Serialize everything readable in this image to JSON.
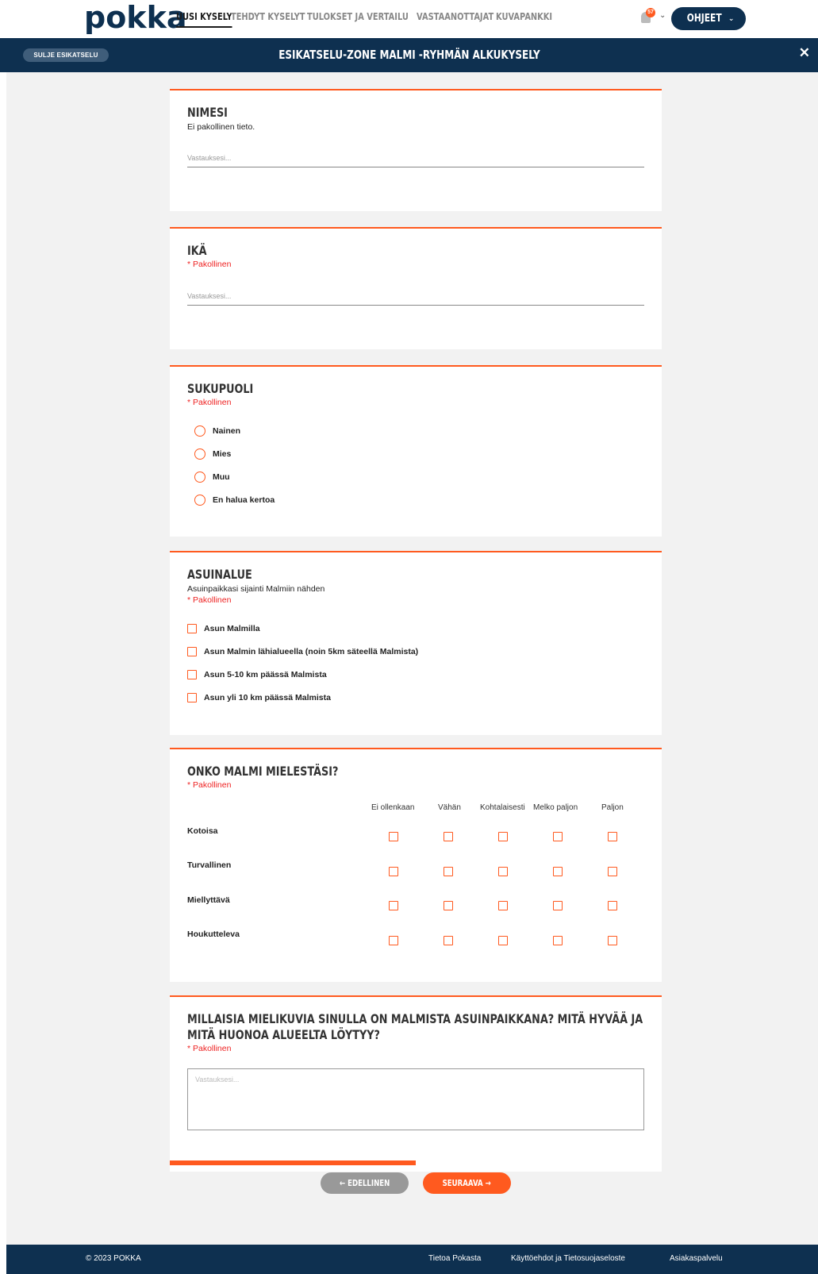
{
  "nav": {
    "logo": "pokka",
    "items": [
      {
        "label": "UUSI KYSELY",
        "active": true
      },
      {
        "label": "TEHDYT KYSELYT",
        "active": false
      },
      {
        "label": "TULOKSET JA VERTAILU",
        "active": false
      },
      {
        "label": "VASTAANOTTAJAT",
        "active": false
      },
      {
        "label": "KUVAPANKKI",
        "active": false
      }
    ],
    "notification_count": "57",
    "help_label": "OHJEET"
  },
  "preview": {
    "close_label": "SULJE ESIKATSELU",
    "title": "ESIKATSELU-ZONE MALMI -RYHMÄN ALKUKYSELY",
    "close_icon": "close-icon"
  },
  "placeholder": "Vastauksesi...",
  "required_text": "* Pakollinen",
  "questions": {
    "name": {
      "title": "NIMESI",
      "sub": "Ei pakollinen tieto."
    },
    "age": {
      "title": "IKÄ"
    },
    "gender": {
      "title": "SUKUPUOLI",
      "options": [
        "Nainen",
        "Mies",
        "Muu",
        "En halua kertoa"
      ]
    },
    "area": {
      "title": "ASUINALUE",
      "sub": "Asuinpaikkasi sijainti Malmiin nähden",
      "options": [
        "Asun Malmilla",
        "Asun Malmin lähialueella (noin 5km säteellä Malmista)",
        "Asun 5-10 km päässä Malmista",
        "Asun yli 10 km päässä Malmista"
      ]
    },
    "matrix": {
      "title": "ONKO MALMI MIELESTÄSI?",
      "columns": [
        "Ei ollenkaan",
        "Vähän",
        "Kohtalaisesti",
        "Melko paljon",
        "Paljon"
      ],
      "rows": [
        "Kotoisa",
        "Turvallinen",
        "Miellyttävä",
        "Houkutteleva"
      ]
    },
    "open": {
      "title": "MILLAISIA MIELIKUVIA SINULLA ON MALMISTA ASUINPAIKKANA? MITÄ HYVÄÄ JA MITÄ HUONOA ALUEELTA LÖYTYY?"
    }
  },
  "progress": 0.5,
  "buttons": {
    "prev": "← EDELLINEN",
    "next": "SEURAAVA →"
  },
  "footer": {
    "copyright": "© 2023 POKKA",
    "links": [
      "Tietoa Pokasta",
      "Käyttöehdot ja Tietosuojaseloste",
      "Asiakaspalvelu"
    ]
  },
  "colors": {
    "accent": "#ff5a1f",
    "navy": "#0e3050",
    "background": "#f2f2f2"
  }
}
